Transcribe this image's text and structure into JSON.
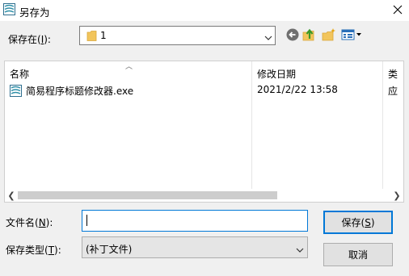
{
  "window": {
    "title": "另存为"
  },
  "location": {
    "label_pre": "保存在(",
    "label_key": "I",
    "label_post": "):",
    "value": "1"
  },
  "toolbar": {
    "back_icon": "back-arrow-icon",
    "up_icon": "up-folder-icon",
    "new_folder_icon": "new-folder-icon",
    "views_icon": "views-menu-icon"
  },
  "file_list": {
    "columns": [
      "名称",
      "修改日期",
      "类"
    ],
    "rows": [
      {
        "name": "简易程序标题修改器.exe",
        "date": "2021/2/22 13:58",
        "type": "应"
      }
    ]
  },
  "filename": {
    "label_pre": "文件名(",
    "label_key": "N",
    "label_post": "):",
    "value": ""
  },
  "filetype": {
    "label_pre": "保存类型(",
    "label_key": "T",
    "label_post": "):",
    "value": "(补丁文件)"
  },
  "buttons": {
    "save_pre": "保存(",
    "save_key": "S",
    "save_post": ")",
    "cancel": "取消"
  },
  "colors": {
    "accent": "#0078d7",
    "dialog_bg": "#f0f0f0",
    "folder": "#f2c55c"
  }
}
